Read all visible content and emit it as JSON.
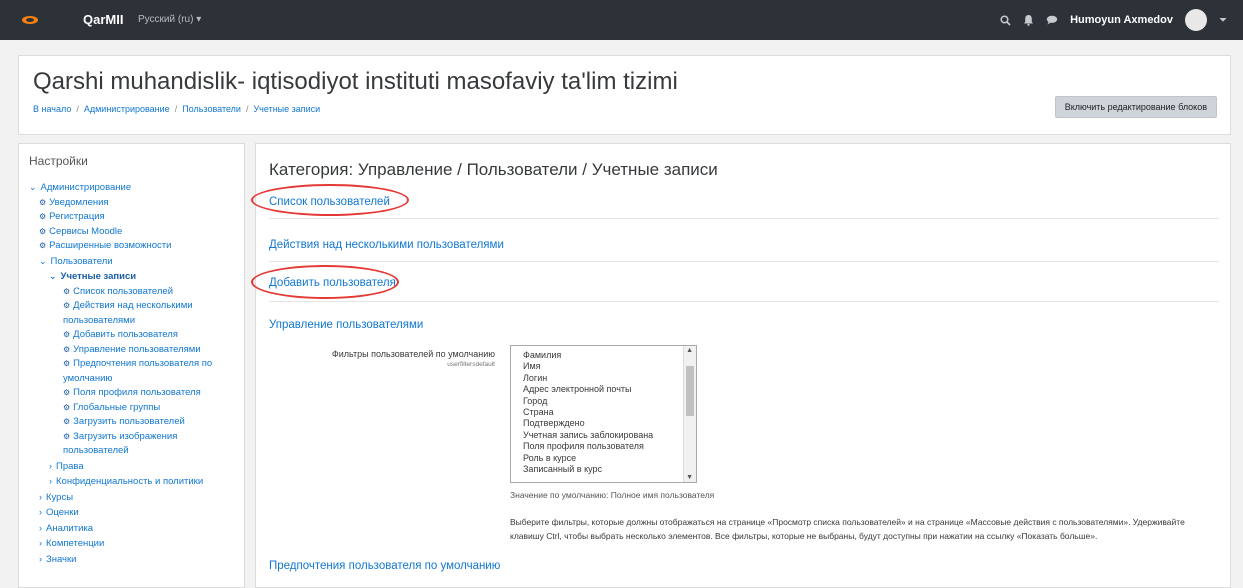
{
  "navbar": {
    "brand": "QarMII",
    "language": "Русский (ru) ▾",
    "user": "Humoyun Axmedov",
    "icons": [
      "search-icon",
      "bell-icon",
      "chat-icon",
      "caret-down-icon"
    ]
  },
  "header": {
    "title": "Qarshi muhandislik- iqtisodiyot instituti masofaviy ta'lim tizimi",
    "breadcrumb": [
      "В начало",
      "Администрирование",
      "Пользователи",
      "Учетные записи"
    ],
    "edit_button": "Включить редактирование блоков"
  },
  "sidebar": {
    "title": "Настройки",
    "items": [
      "Администрирование",
      "Уведомления",
      "Регистрация",
      "Сервисы Moodle",
      "Расширенные возможности",
      "Пользователи",
      "Учетные записи",
      "Список пользователей",
      "Действия над несколькими пользователями",
      "Добавить пользователя",
      "Управление пользователями",
      "Предпочтения пользователя по умолчанию",
      "Поля профиля пользователя",
      "Глобальные группы",
      "Загрузить пользователей",
      "Загрузить изображения пользователей",
      "Права",
      "Конфиденциальность и политики",
      "Курсы",
      "Оценки",
      "Аналитика",
      "Компетенции",
      "Значки"
    ]
  },
  "main": {
    "category_title": "Категория: Управление / Пользователи / Учетные записи",
    "links": {
      "user_list": "Список пользователей",
      "bulk_actions": "Действия над несколькими пользователями",
      "add_user": "Добавить пользователя",
      "manage_users": "Управление пользователями",
      "default_prefs": "Предпочтения пользователя по умолчанию"
    },
    "setting": {
      "label": "Фильтры пользователей по умолчанию",
      "name": "userfiltersdefault",
      "options": [
        "Фамилия",
        "Имя",
        "Логин",
        "Адрес электронной почты",
        "Город",
        "Страна",
        "Подтверждено",
        "Учетная запись заблокирована",
        "Поля профиля пользователя",
        "Роль в курсе",
        "Записанный в курс"
      ],
      "default_note": "Значение по умолчанию: Полное имя пользователя",
      "description": "Выберите фильтры, которые должны отображаться на странице «Просмотр списка пользователей» и на странице «Массовые действия с пользователями». Удерживайте клавишу Ctrl, чтобы выбрать несколько элементов. Все фильтры, которые не выбраны, будут доступны при нажатии на ссылку «Показать больше»."
    }
  }
}
